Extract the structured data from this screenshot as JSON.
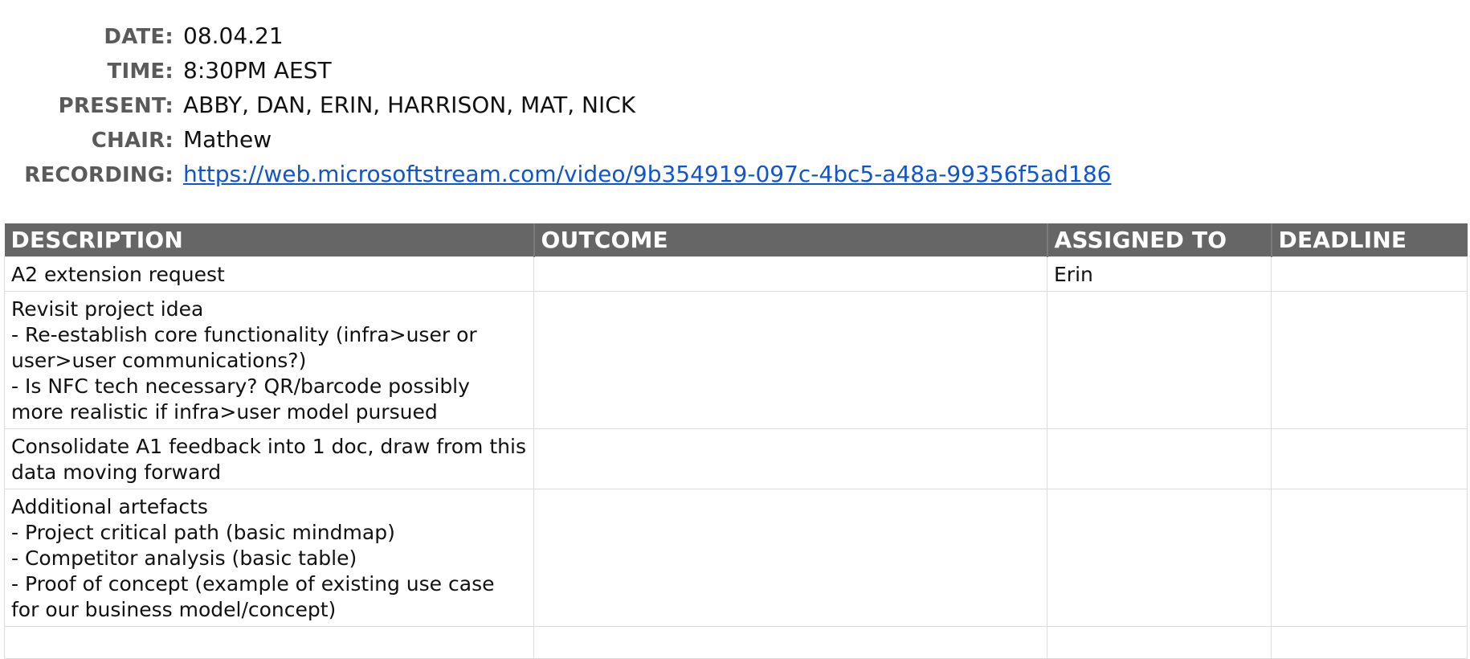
{
  "meta": {
    "date_label": "DATE:",
    "date_value": "08.04.21",
    "time_label": "TIME:",
    "time_value": "8:30PM AEST",
    "present_label": "PRESENT:",
    "present_value": "ABBY, DAN, ERIN, HARRISON, MAT, NICK",
    "chair_label": "CHAIR:",
    "chair_value": "Mathew",
    "recording_label": "RECORDING:",
    "recording_link": "https://web.microsoftstream.com/video/9b354919-097c-4bc5-a48a-99356f5ad186"
  },
  "table": {
    "headers": [
      "DESCRIPTION",
      "OUTCOME",
      "ASSIGNED TO",
      "DEADLINE"
    ],
    "rows": [
      {
        "description": [
          "A2 extension request"
        ],
        "outcome": "",
        "assigned_to": "Erin",
        "deadline": ""
      },
      {
        "description": [
          "Revisit project idea",
          "- Re-establish core functionality (infra>user or user>user communications?)",
          "- Is NFC tech necessary? QR/barcode possibly more realistic if infra>user model pursued"
        ],
        "outcome": "",
        "assigned_to": "",
        "deadline": ""
      },
      {
        "description": [
          "Consolidate A1 feedback into 1 doc, draw from this data moving forward"
        ],
        "outcome": "",
        "assigned_to": "",
        "deadline": ""
      },
      {
        "description": [
          "Additional artefacts",
          "- Project critical path (basic mindmap)",
          "- Competitor analysis (basic table)",
          "- Proof of concept (example of existing use case for our business model/concept)"
        ],
        "outcome": "",
        "assigned_to": "",
        "deadline": ""
      },
      {
        "description": [
          ""
        ],
        "outcome": "",
        "assigned_to": "",
        "deadline": ""
      }
    ]
  }
}
